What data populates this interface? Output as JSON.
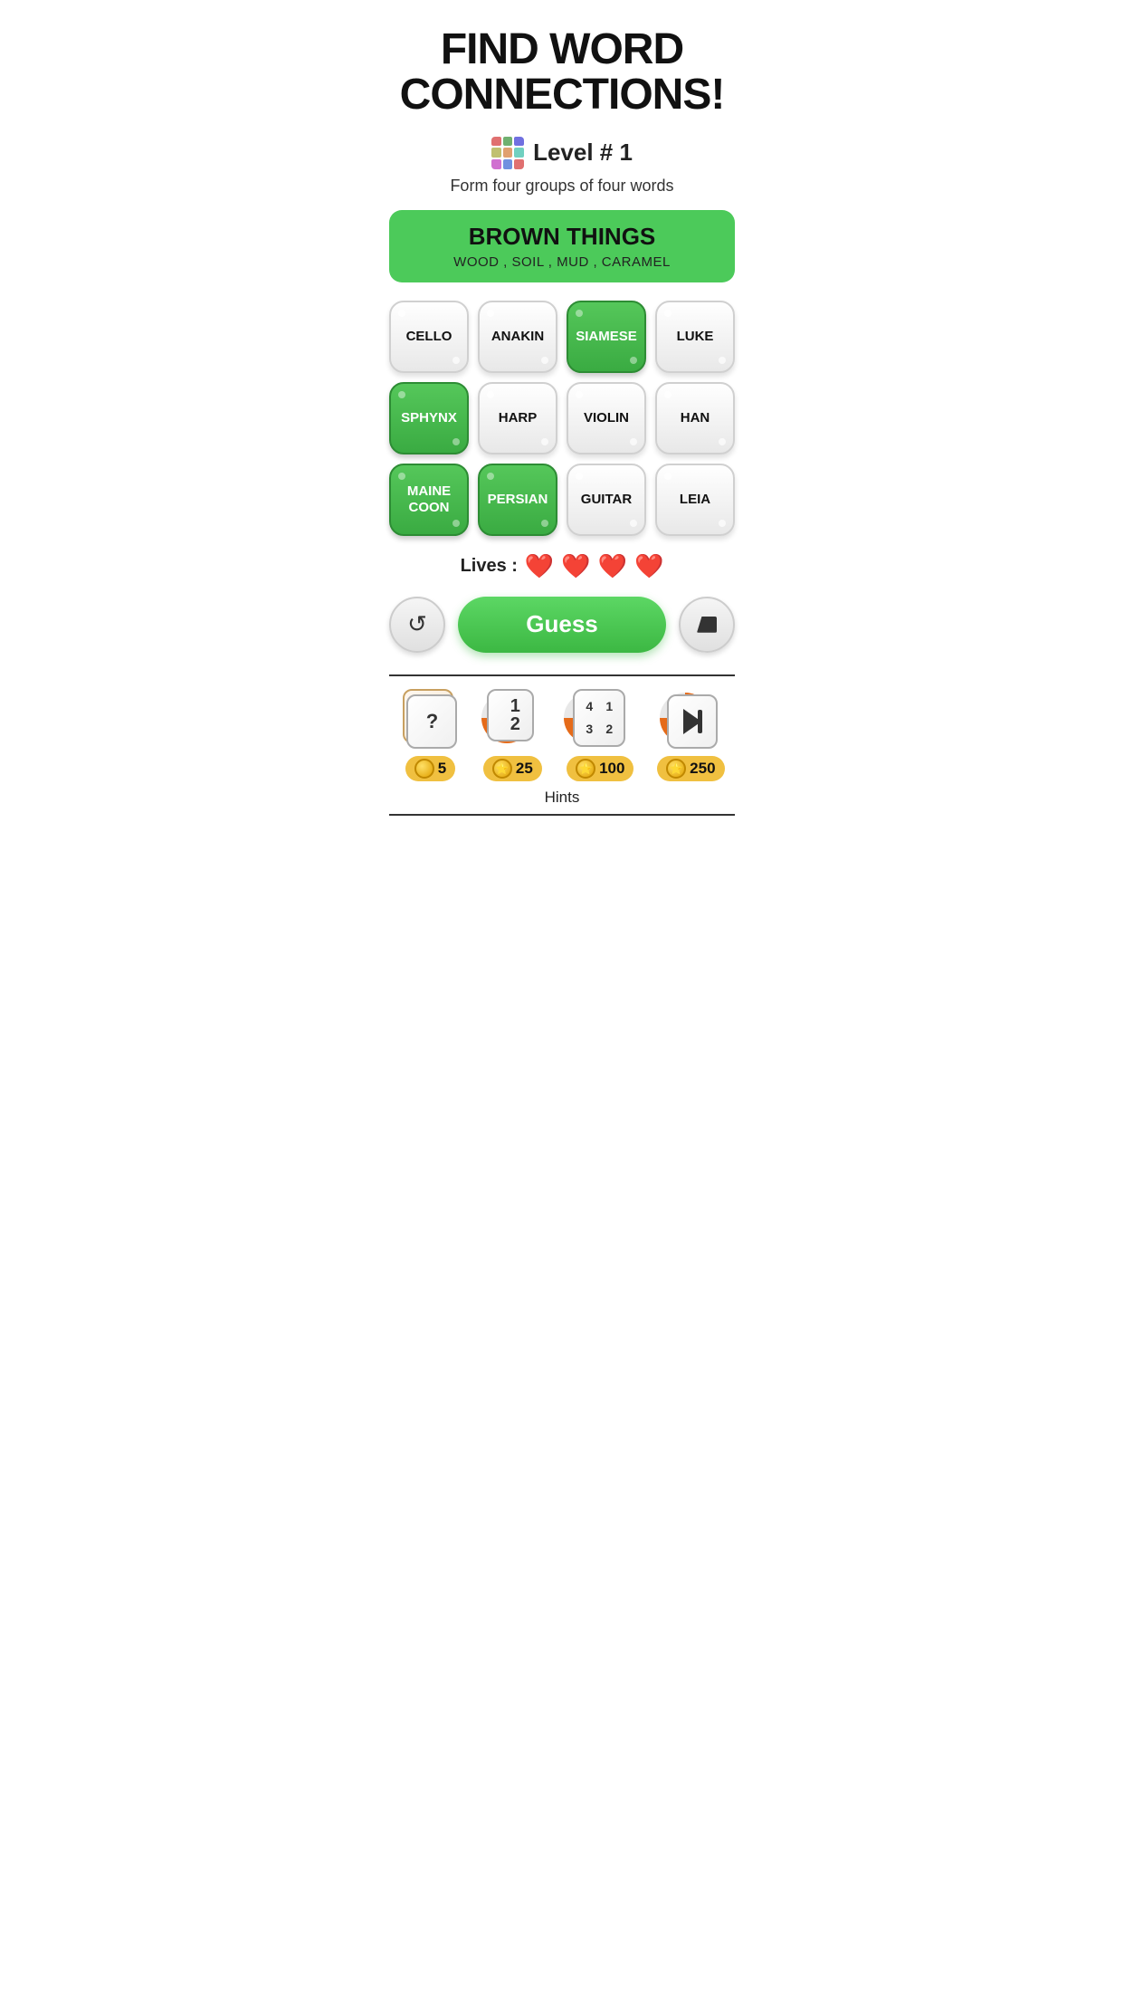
{
  "header": {
    "title_line1": "FIND WORD",
    "title_line2": "CONNECTIONS!",
    "level_label": "Level # 1",
    "subtitle": "Form four groups of four words"
  },
  "category": {
    "title": "BROWN THINGS",
    "words": "WOOD , SOIL , MUD , CARAMEL"
  },
  "grid": [
    {
      "id": "cello",
      "label": "CELLO",
      "selected": false
    },
    {
      "id": "anakin",
      "label": "ANAKIN",
      "selected": false
    },
    {
      "id": "siamese",
      "label": "SIAMESE",
      "selected": true
    },
    {
      "id": "luke",
      "label": "LUKE",
      "selected": false
    },
    {
      "id": "sphynx",
      "label": "SPHYNX",
      "selected": true
    },
    {
      "id": "harp",
      "label": "HARP",
      "selected": false
    },
    {
      "id": "violin",
      "label": "VIOLIN",
      "selected": false
    },
    {
      "id": "han",
      "label": "HAN",
      "selected": false
    },
    {
      "id": "maine-coon",
      "label": "MAINE COON",
      "selected": true
    },
    {
      "id": "persian",
      "label": "PERSIAN",
      "selected": true
    },
    {
      "id": "guitar",
      "label": "GUITAR",
      "selected": false
    },
    {
      "id": "leia",
      "label": "LEIA",
      "selected": false
    }
  ],
  "lives": {
    "label": "Lives :",
    "count": 4,
    "heart_emoji": "❤️"
  },
  "actions": {
    "refresh_label": "↺",
    "guess_label": "Guess",
    "eraser_label": "◆"
  },
  "hints": [
    {
      "id": "hint-question",
      "type": "question",
      "symbol": "?",
      "cost": "5"
    },
    {
      "id": "hint-swap",
      "type": "swap",
      "numbers": [
        "1",
        "2"
      ],
      "cost": "25"
    },
    {
      "id": "hint-reveal",
      "type": "reveal",
      "numbers": [
        "4",
        "1",
        "3",
        "2"
      ],
      "cost": "100"
    },
    {
      "id": "hint-skip",
      "type": "skip",
      "cost": "250"
    }
  ],
  "hints_label": "Hints",
  "colors": {
    "selected_green": "#3aab42",
    "banner_green": "#4cca5a",
    "guess_green": "#3cb843",
    "heart_red": "#e53935",
    "coin_gold": "#f0c040"
  }
}
